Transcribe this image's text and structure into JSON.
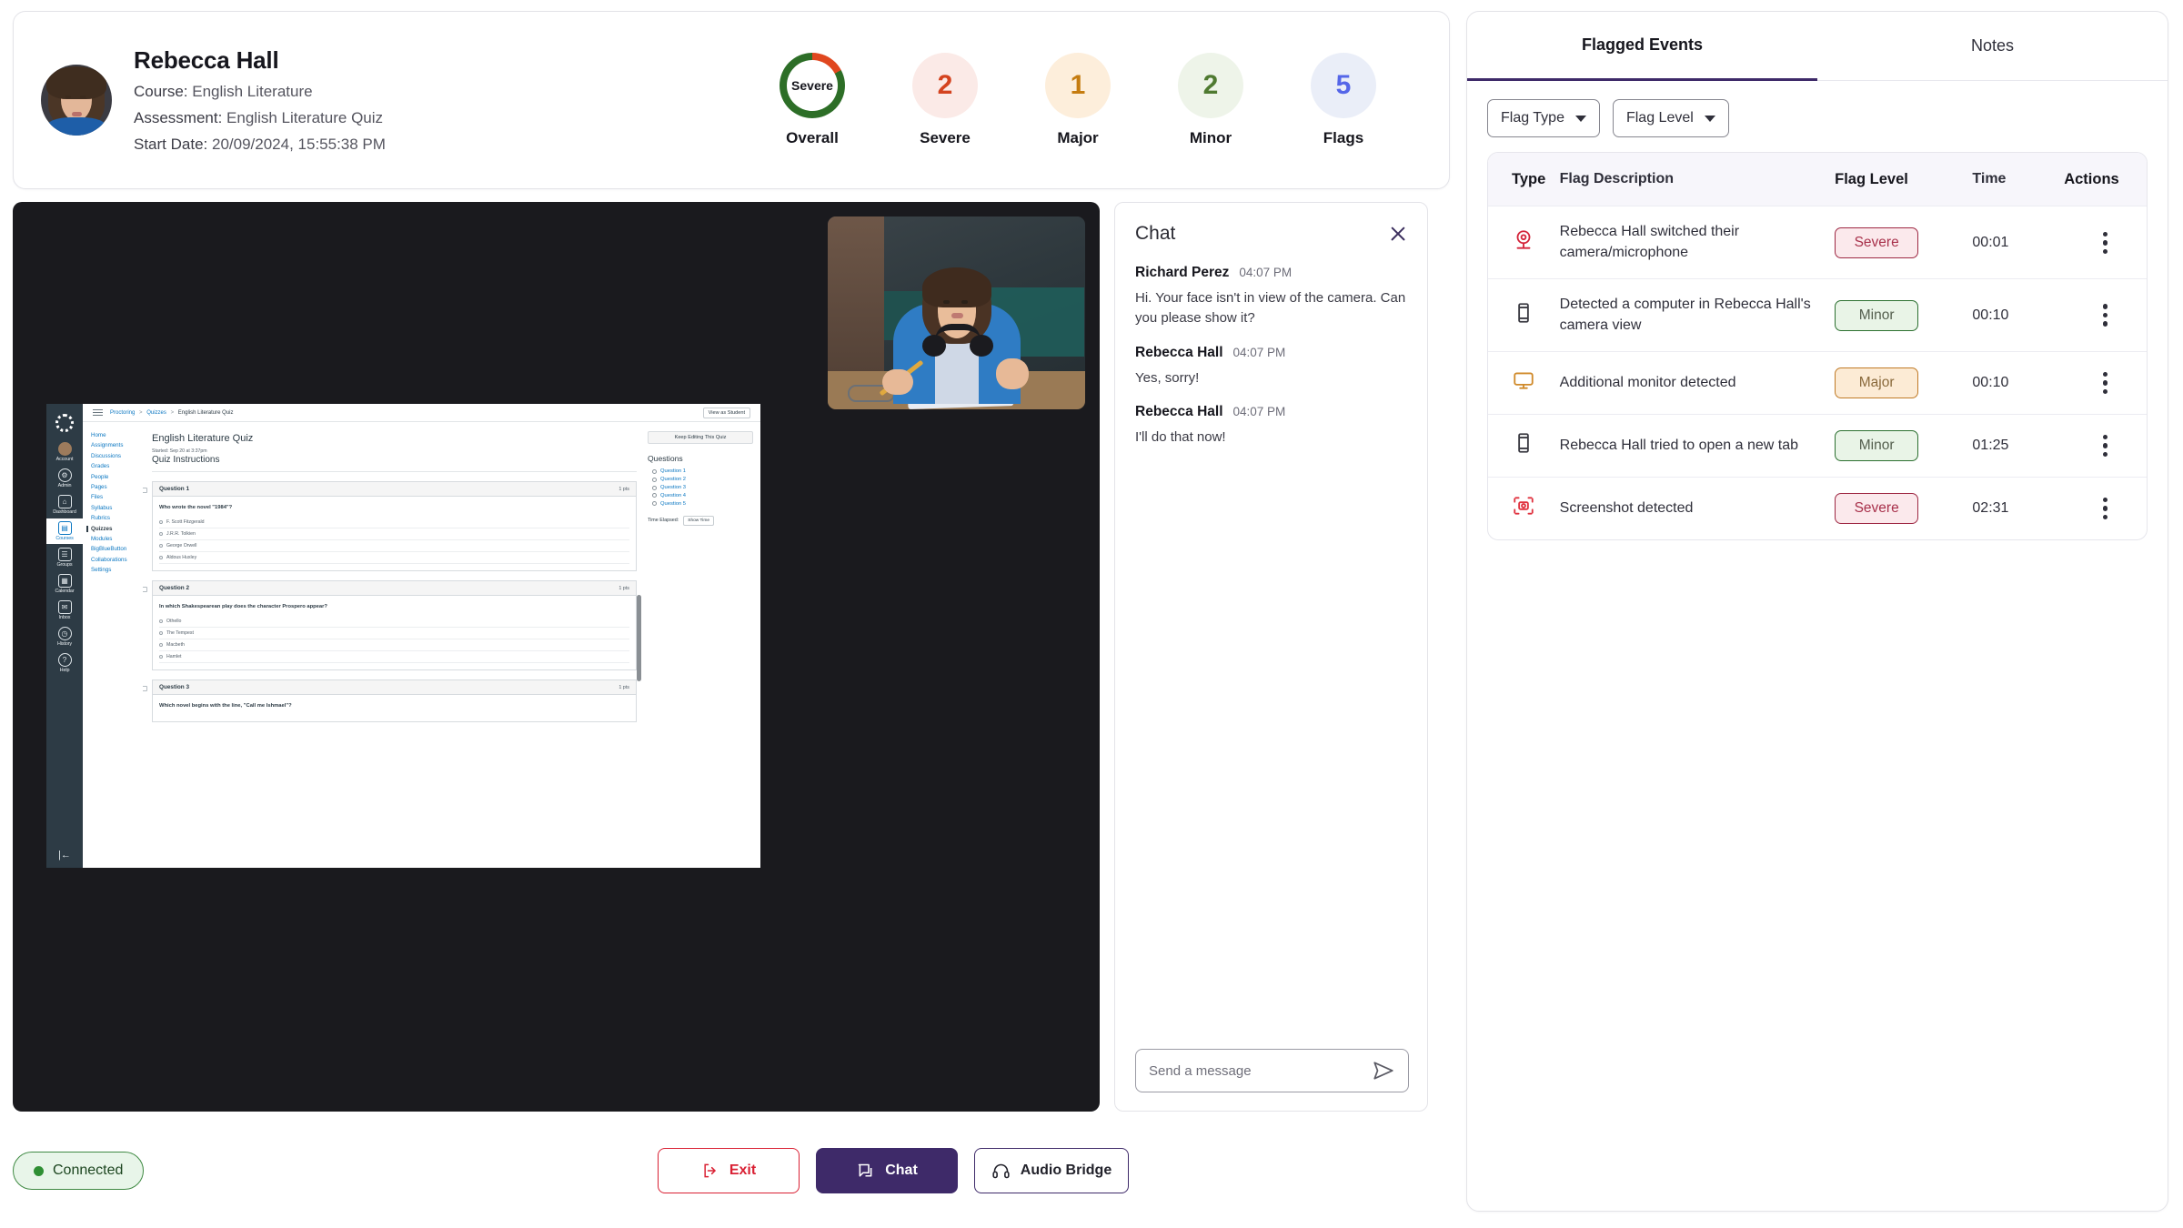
{
  "student": {
    "name": "Rebecca Hall",
    "course_label": "Course:",
    "course": "English Literature",
    "assessment_label": "Assessment:",
    "assessment": "English Literature Quiz",
    "start_label": "Start Date:",
    "start_date": "20/09/2024, 15:55:38 PM"
  },
  "stats": [
    {
      "key": "overall",
      "value": "Severe",
      "label": "Overall",
      "type": "donut",
      "ring_color": "#2d6e27",
      "ring_accent": "#e0471f"
    },
    {
      "key": "severe",
      "value": "2",
      "label": "Severe",
      "type": "bubble",
      "bg": "#fbeae7",
      "fg": "#d4431f"
    },
    {
      "key": "major",
      "value": "1",
      "label": "Major",
      "type": "bubble",
      "bg": "#fdeedb",
      "fg": "#c57c10"
    },
    {
      "key": "minor",
      "value": "2",
      "label": "Minor",
      "type": "bubble",
      "bg": "#eef4e9",
      "fg": "#4f7a31"
    },
    {
      "key": "flags",
      "value": "5",
      "label": "Flags",
      "type": "bubble",
      "bg": "#eaeef8",
      "fg": "#5566e8"
    }
  ],
  "screen_share": {
    "breadcrumb": {
      "root": "Proctoring",
      "section": "Quizzes",
      "current": "English Literature Quiz"
    },
    "view_as_student": "View as Student",
    "course_nav": [
      "Home",
      "Assignments",
      "Discussions",
      "Grades",
      "People",
      "Pages",
      "Files",
      "Syllabus",
      "Rubrics",
      "Quizzes",
      "Modules",
      "BigBlueButton",
      "Collaborations",
      "Settings"
    ],
    "course_nav_active": "Quizzes",
    "global_nav": [
      {
        "label": "Account",
        "icon": "avatar-icon"
      },
      {
        "label": "Admin",
        "icon": "admin-icon"
      },
      {
        "label": "Dashboard",
        "icon": "dashboard-icon"
      },
      {
        "label": "Courses",
        "icon": "courses-icon"
      },
      {
        "label": "Groups",
        "icon": "groups-icon"
      },
      {
        "label": "Calendar",
        "icon": "calendar-icon"
      },
      {
        "label": "Inbox",
        "icon": "inbox-icon"
      },
      {
        "label": "History",
        "icon": "history-icon"
      },
      {
        "label": "Help",
        "icon": "help-icon"
      }
    ],
    "quiz_title": "English Literature Quiz",
    "started": "Started: Sep 20 at 3:37pm",
    "instructions_heading": "Quiz Instructions",
    "keep_editing": "Keep Editing This Quiz",
    "questions_heading": "Questions",
    "question_links": [
      "Question 1",
      "Question 2",
      "Question 3",
      "Question 4",
      "Question 5"
    ],
    "time_elapsed_label": "Time Elapsed:",
    "show_time": "Show Time",
    "points_label": "1 pts",
    "questions": [
      {
        "number": "Question 1",
        "points": "1 pts",
        "text": "Who wrote the novel \"1984\"?",
        "options": [
          "F. Scott Fitzgerald",
          "J.R.R. Tolkien",
          "George Orwell",
          "Aldous Huxley"
        ]
      },
      {
        "number": "Question 2",
        "points": "1 pts",
        "text": "In which Shakespearean play does the character Prospero appear?",
        "options": [
          "Othello",
          "The Tempest",
          "Macbeth",
          "Hamlet"
        ]
      },
      {
        "number": "Question 3",
        "points": "1 pts",
        "text": "Which novel begins with the line, \"Call me Ishmael\"?",
        "options": []
      }
    ]
  },
  "chat": {
    "title": "Chat",
    "close_icon": "close-icon",
    "messages": [
      {
        "author": "Richard Perez",
        "time": "04:07 PM",
        "text": "Hi. Your face isn't in view of the camera. Can you please show it?"
      },
      {
        "author": "Rebecca Hall",
        "time": "04:07 PM",
        "text": "Yes, sorry!"
      },
      {
        "author": "Rebecca Hall",
        "time": "04:07 PM",
        "text": "I'll do that now!"
      }
    ],
    "input_placeholder": "Send a message",
    "input_value": "",
    "send_icon": "send-icon"
  },
  "bottom": {
    "connection_status": "Connected",
    "exit_label": "Exit",
    "chat_label": "Chat",
    "audio_label": "Audio Bridge"
  },
  "right_panel": {
    "tabs": [
      {
        "label": "Flagged Events",
        "active": true
      },
      {
        "label": "Notes",
        "active": false
      }
    ],
    "filters": [
      {
        "label": "Flag Type"
      },
      {
        "label": "Flag Level"
      }
    ],
    "table": {
      "headers": [
        "Type",
        "Flag Description",
        "Flag Level",
        "Time",
        "Actions"
      ],
      "rows": [
        {
          "icon": "webcam-icon",
          "icon_color": "#d4243a",
          "description": "Rebecca Hall switched their camera/microphone",
          "level": "Severe",
          "level_class": "b-severe",
          "time": "00:01"
        },
        {
          "icon": "phone-icon",
          "icon_color": "#3a3a42",
          "description": "Detected a computer in Rebecca Hall's camera view",
          "level": "Minor",
          "level_class": "b-minor",
          "time": "00:10"
        },
        {
          "icon": "monitor-icon",
          "icon_color": "#d08a2a",
          "description": "Additional monitor detected",
          "level": "Major",
          "level_class": "b-major",
          "time": "00:10"
        },
        {
          "icon": "phone-icon",
          "icon_color": "#3a3a42",
          "description": "Rebecca Hall tried to open a new tab",
          "level": "Minor",
          "level_class": "b-minor",
          "time": "01:25"
        },
        {
          "icon": "screenshot-icon",
          "icon_color": "#e0323f",
          "description": "Screenshot detected",
          "level": "Severe",
          "level_class": "b-severe",
          "time": "02:31"
        }
      ]
    }
  }
}
